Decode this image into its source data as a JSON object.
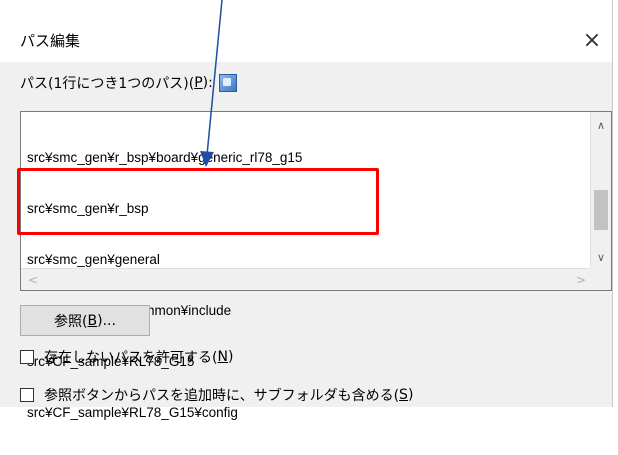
{
  "dialog": {
    "title": "パス編集",
    "close_glyph": "×"
  },
  "path_label": {
    "text": "パス(1行につき1つのパス)(",
    "accel": "P",
    "suffix": "):"
  },
  "paths": [
    "src¥smc_gen¥r_bsp¥board¥generic_rl78_g15",
    "src¥smc_gen¥r_bsp",
    "src¥smc_gen¥general",
    "src¥CF_sample¥common¥include",
    "src¥CF_sample¥RL78_G15",
    "src¥CF_sample¥RL78_G15¥config"
  ],
  "scrollbar": {
    "up": "∧",
    "down": "∨",
    "left": "<",
    "right": ">"
  },
  "browse_button": {
    "text": "参照(",
    "accel": "B",
    "suffix": ")..."
  },
  "options": [
    {
      "text": "存在しないパスを許可する(",
      "accel": "N",
      "suffix": ")"
    },
    {
      "text": "参照ボタンからパスを追加時に、サブフォルダも含める(",
      "accel": "S",
      "suffix": ")"
    }
  ],
  "annotation": {
    "highlight_color": "#ff0000",
    "arrow_color": "#1f4fa0"
  }
}
